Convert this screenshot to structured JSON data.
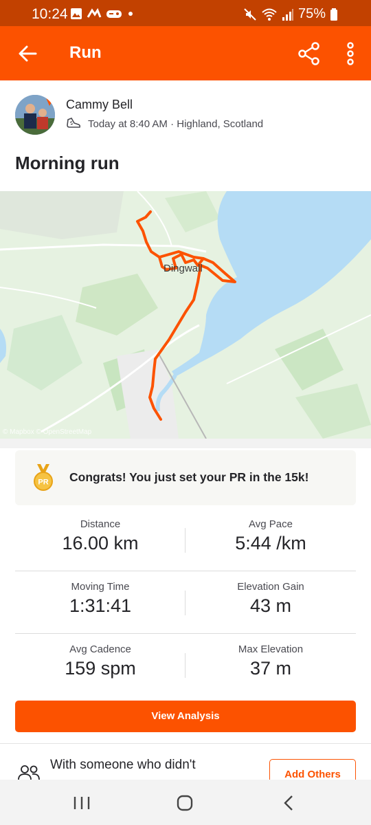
{
  "status_bar": {
    "time": "10:24",
    "battery": "75%",
    "notification_icons": [
      "image-icon",
      "strava-icon",
      "gamepad-icon",
      "dot-icon"
    ],
    "system_icons": [
      "mute-icon",
      "wifi-icon",
      "signal-icon",
      "battery-icon"
    ]
  },
  "app_bar": {
    "title": "Run"
  },
  "athlete": {
    "name": "Cammy Bell",
    "meta": "Today at 8:40 AM · Highland, Scotland"
  },
  "activity": {
    "title": "Morning run"
  },
  "map": {
    "town_label": "Dingwall",
    "attribution": "© Mapbox © OpenStreetMap"
  },
  "pr": {
    "text": "Congrats! You just set your PR in the 15k!",
    "medal_text": "PR"
  },
  "stats": [
    {
      "left": {
        "label": "Distance",
        "value": "16.00 km"
      },
      "right": {
        "label": "Avg Pace",
        "value": "5:44 /km"
      }
    },
    {
      "left": {
        "label": "Moving Time",
        "value": "1:31:41"
      },
      "right": {
        "label": "Elevation Gain",
        "value": "43 m"
      }
    },
    {
      "left": {
        "label": "Avg Cadence",
        "value": "159 spm"
      },
      "right": {
        "label": "Max Elevation",
        "value": "37 m"
      }
    }
  ],
  "analysis_button": "View Analysis",
  "group": {
    "text": "With someone who didn't",
    "button": "Add Others"
  },
  "colors": {
    "brand": "#fc5200",
    "status_bar": "#c24100",
    "route": "#fc5200",
    "water": "#b5dcf5"
  }
}
